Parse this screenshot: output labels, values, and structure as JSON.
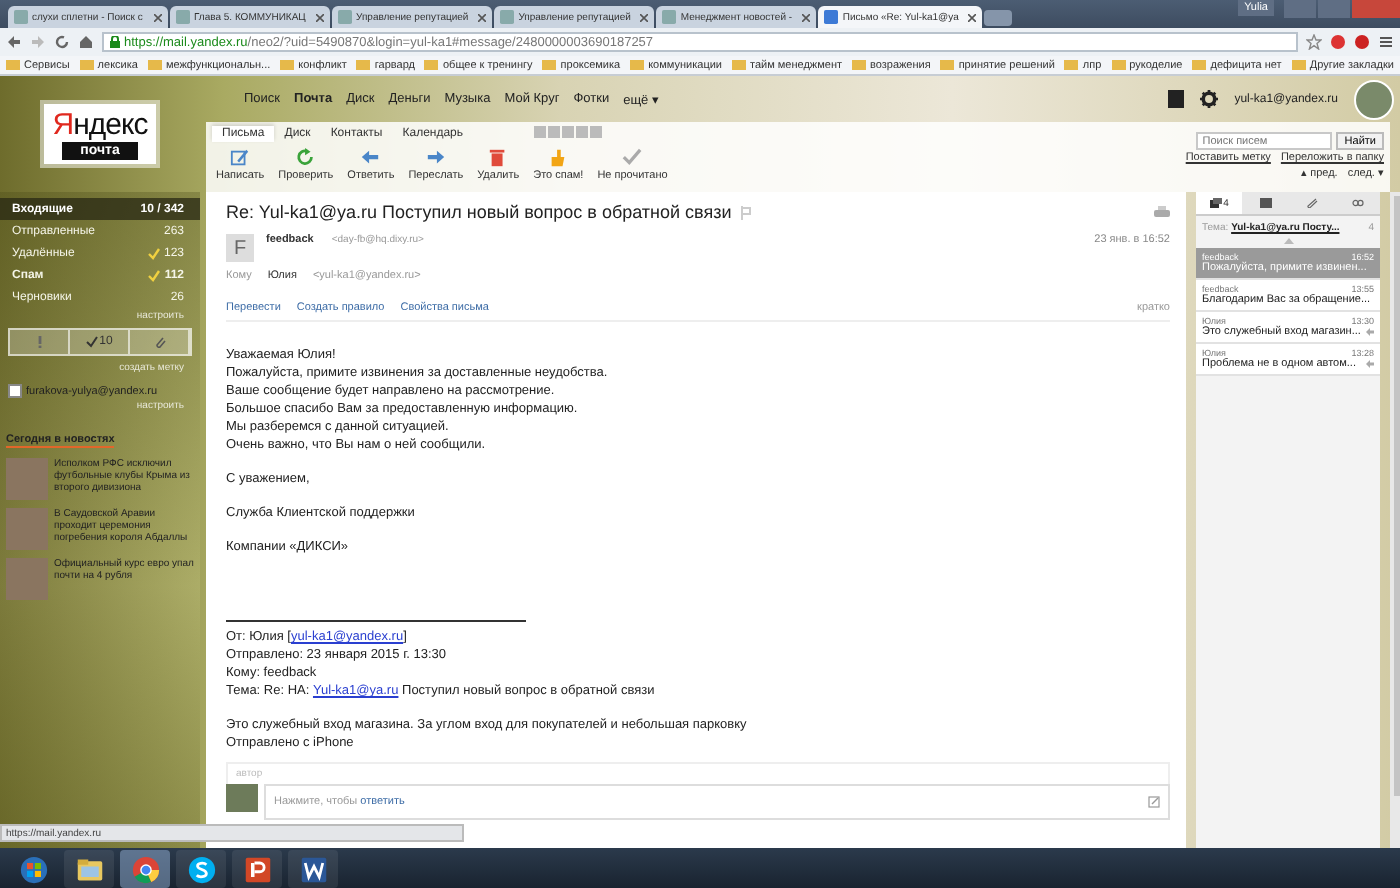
{
  "browser": {
    "tabs": [
      {
        "title": "слухи сплетни - Поиск с",
        "selected": false
      },
      {
        "title": "Глава 5. КОММУНИКАЦ",
        "selected": false
      },
      {
        "title": "Управление репутацией",
        "selected": false
      },
      {
        "title": "Управление репутацией",
        "selected": false
      },
      {
        "title": "Менеджмент новостей -",
        "selected": false
      },
      {
        "title": "Письмо «Re: Yul-ka1@ya",
        "selected": true
      }
    ],
    "user": "Yulia",
    "url_host": "https://mail.yandex.ru",
    "url_path": "/neo2/?uid=5490870&login=yul-ka1#message/2480000003690187257",
    "bookmarks": [
      "Сервисы",
      "лексика",
      "межфункциональн...",
      "конфликт",
      "гарвард",
      "общее к тренингу",
      "проксемика",
      "коммуникации",
      "тайм менеджмент",
      "возражения",
      "принятие решений",
      "лпр",
      "рукоделие",
      "дефицита нет"
    ],
    "other_bookmarks": "Другие закладки",
    "status_url": "https://mail.yandex.ru"
  },
  "header": {
    "logo": "Яндекс",
    "logo_sub": "почта",
    "services": [
      {
        "label": "Поиск",
        "selected": false
      },
      {
        "label": "Почта",
        "selected": true
      },
      {
        "label": "Диск",
        "selected": false
      },
      {
        "label": "Деньги",
        "selected": false
      },
      {
        "label": "Музыка",
        "selected": false
      },
      {
        "label": "Мой Круг",
        "selected": false
      },
      {
        "label": "Фотки",
        "selected": false
      },
      {
        "label": "ещё ▾",
        "selected": false
      }
    ],
    "user_email": "yul-ka1@yandex.ru"
  },
  "mail_tabs": [
    {
      "label": "Письма",
      "selected": true
    },
    {
      "label": "Диск",
      "selected": false
    },
    {
      "label": "Контакты",
      "selected": false
    },
    {
      "label": "Календарь",
      "selected": false
    }
  ],
  "toolbar": [
    {
      "kind": "compose",
      "label": "Написать"
    },
    {
      "kind": "check",
      "label": "Проверить"
    },
    {
      "kind": "reply",
      "label": "Ответить"
    },
    {
      "kind": "forward",
      "label": "Переслать"
    },
    {
      "kind": "delete",
      "label": "Удалить"
    },
    {
      "kind": "spam",
      "label": "Это спам!"
    },
    {
      "kind": "unread",
      "label": "Не прочитано"
    }
  ],
  "search": {
    "placeholder": "Поиск писем",
    "button": "Найти",
    "links": [
      "Поставить метку",
      "Переложить в папку"
    ],
    "prev": "▴ пред.",
    "next": "след. ▾"
  },
  "folders": [
    {
      "name": "Входящие",
      "count": "**10** / 342",
      "selected": true,
      "unread": true,
      "cleanable": false
    },
    {
      "name": "Отправленные",
      "count": "263",
      "selected": false,
      "unread": false,
      "cleanable": false
    },
    {
      "name": "Удалённые",
      "count": "123",
      "selected": false,
      "unread": false,
      "cleanable": true
    },
    {
      "name": "Спам",
      "count": "112",
      "selected": false,
      "unread": true,
      "cleanable": true
    },
    {
      "name": "Черновики",
      "count": "26",
      "selected": false,
      "unread": false,
      "cleanable": false
    }
  ],
  "folders_setup": "настроить",
  "filters": [
    {
      "kind": "important"
    },
    {
      "kind": "unread",
      "count": "10"
    },
    {
      "kind": "attachments"
    }
  ],
  "create_label": "создать метку",
  "account": {
    "email": "furakova-yulya@yandex.ru",
    "setup": "настроить"
  },
  "news": {
    "title": "Сегодня в новостях",
    "items": [
      "Исполком РФС исключил футбольные клубы Крыма из второго дивизиона",
      "В Саудовской Аравии проходит церемония погребения короля Абдаллы",
      "Официальный курс евро упал почти на 4 рубля"
    ]
  },
  "message": {
    "subject": "Re: Yul-ka1@ya.ru Поступил новый вопрос в обратной связи",
    "sender_initial": "F",
    "sender_name": "feedback",
    "sender_email": "<day-fb@hq.dixy.ru>",
    "date": "23 янв. в 16:52",
    "to_label": "Кому",
    "to_name": "Юлия",
    "to_email": "<yul-ka1@yandex.ru>",
    "actions": [
      "Перевести",
      "Создать правило",
      "Свойства письма"
    ],
    "brief": "кратко",
    "body": [
      [
        "Уважаемая Юлия!",
        "Пожалуйста, примите извинения за доставленные неудобства.",
        "Ваше сообщение будет направлено на рассмотрение.",
        "Большое спасибо Вам за предоставленную информацию.",
        "Мы разберемся с данной ситуацией.",
        "Очень важно, что Вы нам о ней сообщили."
      ],
      [
        "С уважением,"
      ],
      [
        "Служба Клиентской поддержки"
      ],
      [
        "Компании «ДИКСИ»"
      ]
    ],
    "quote": [
      [
        {
          "text": "От: Юлия [",
          "link": "yul-ka1@yandex.ru",
          "after": "]"
        },
        {
          "text": "Отправлено: 23 января 2015 г. 13:30"
        },
        {
          "text": "Кому: feedback"
        },
        {
          "text": "Тема: Re: НА: ",
          "link": "Yul-ka1@ya.ru",
          "after": " Поступил новый вопрос в обратной связи"
        }
      ],
      [
        {
          "text": "Это служебный вход магазина. За углом вход для покупателей и небольшая парковку"
        },
        {
          "text": "Отправлено с iPhone"
        }
      ]
    ],
    "author_label": "автор",
    "reply_hint": "Нажмите, чтобы ",
    "reply_link": "ответить"
  },
  "thread": {
    "tabs": [
      {
        "kind": "messages",
        "count": "4",
        "selected": true
      },
      {
        "kind": "envelope",
        "selected": false
      },
      {
        "kind": "attachments",
        "selected": false
      },
      {
        "kind": "links",
        "selected": false
      }
    ],
    "subject_label": "Тема:",
    "subject": "Yul-ka1@ya.ru Посту...",
    "count": "4",
    "items": [
      {
        "from": "feedback",
        "time": "16:52",
        "snippet": "Пожалуйста, примите извинен...",
        "selected": true,
        "replied": false
      },
      {
        "from": "feedback",
        "time": "13:55",
        "snippet": "Благодарим Вас за обращение...",
        "selected": false,
        "replied": false
      },
      {
        "from": "Юлия",
        "time": "13:30",
        "snippet": "Это служебный вход магазин...",
        "selected": false,
        "replied": true
      },
      {
        "from": "Юлия",
        "time": "13:28",
        "snippet": "Проблема не в одном автом...",
        "selected": false,
        "replied": true
      }
    ]
  },
  "taskbar": [
    {
      "kind": "start",
      "selected": false
    },
    {
      "kind": "explorer",
      "selected": false
    },
    {
      "kind": "chrome",
      "selected": true
    },
    {
      "kind": "skype",
      "selected": false
    },
    {
      "kind": "powerpoint",
      "selected": false
    },
    {
      "kind": "word",
      "selected": false
    }
  ]
}
